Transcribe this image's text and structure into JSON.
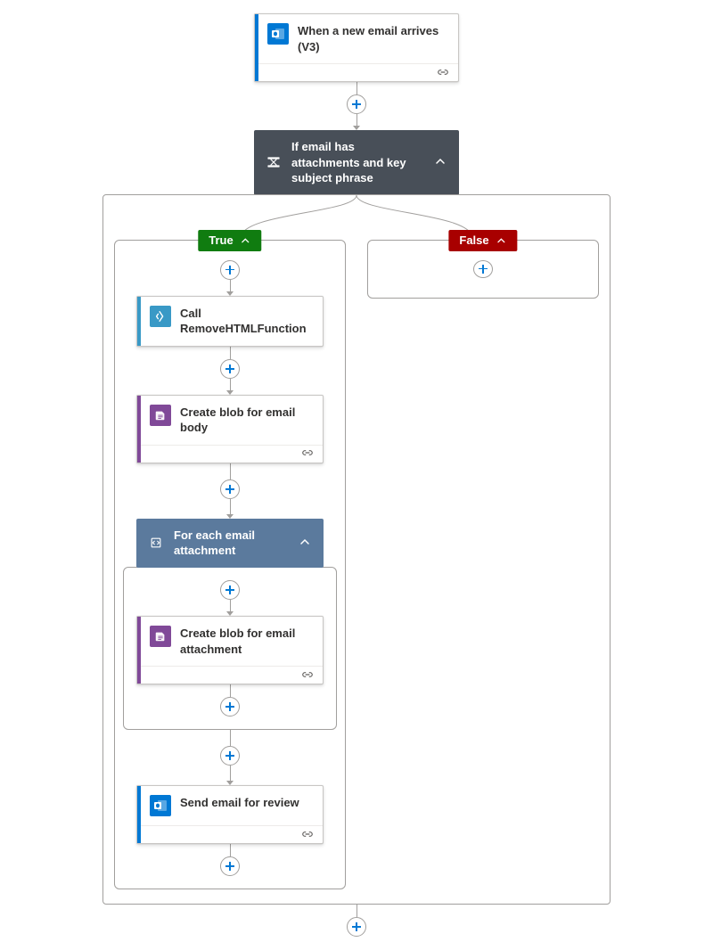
{
  "trigger": {
    "title": "When a new email arrives (V3)"
  },
  "condition": {
    "title": "If email has attachments and key subject phrase",
    "branches": {
      "true_label": "True",
      "false_label": "False"
    }
  },
  "actions": {
    "call_fn": {
      "title": "Call RemoveHTMLFunction"
    },
    "blob_body": {
      "title": "Create blob for email body"
    },
    "loop": {
      "title": "For each email attachment",
      "blob_att": {
        "title": "Create blob for email attachment"
      }
    },
    "send_review": {
      "title": "Send email for review"
    }
  }
}
